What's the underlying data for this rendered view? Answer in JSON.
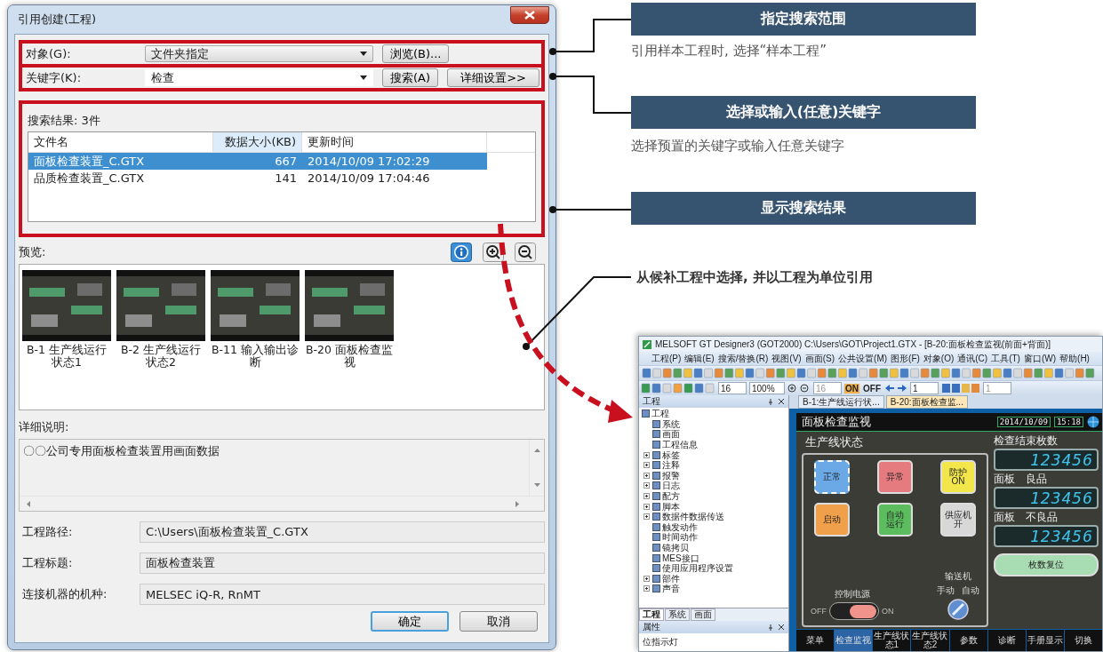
{
  "dialog": {
    "title": "引用创建(工程)",
    "target": {
      "label": "对象(G):",
      "value": "文件夹指定",
      "editable": false,
      "button": "浏览(B)..."
    },
    "keyword": {
      "label": "关键字(K):",
      "value": "检查",
      "editable": true,
      "button": "搜索(A)",
      "detail_button": "详细设置>>"
    },
    "results": {
      "label": "搜索结果: 3件",
      "columns": [
        {
          "label": "文件名",
          "sorted": false
        },
        {
          "label": "数据大小(KB)",
          "sorted": true
        },
        {
          "label": "更新时间",
          "sorted": false
        }
      ],
      "rows": [
        {
          "name": "面板检查装置_C.GTX",
          "size": "667",
          "time": "2014/10/09 17:02:29",
          "selected": true
        },
        {
          "name": "品质检查装置_C.GTX",
          "size": "141",
          "time": "2014/10/09 17:04:46",
          "selected": false
        }
      ]
    },
    "preview": {
      "label": "预览:",
      "items": [
        {
          "caption": "B-1 生产线运行状态1"
        },
        {
          "caption": "B-2 生产线运行状态2"
        },
        {
          "caption": "B-11 输入输出诊断"
        },
        {
          "caption": "B-20 面板检查监视"
        }
      ]
    },
    "description": {
      "label": "详细说明:",
      "text": "〇〇公司专用面板检查装置用画面数据"
    },
    "fields": [
      {
        "label": "工程路径:",
        "value": "C:\\Users\\面板检查装置_C.GTX"
      },
      {
        "label": "工程标题:",
        "value": "面板检查装置"
      },
      {
        "label": "连接机器的机种:",
        "value": "MELSEC iQ-R, RnMT"
      }
    ],
    "buttons": [
      {
        "label": "确定",
        "default": true
      },
      {
        "label": "取消",
        "default": false
      }
    ]
  },
  "callouts": [
    {
      "title": "指定搜索范围",
      "note": "引用样本工程时, 选择“样本工程”"
    },
    {
      "title": "选择或输入(任意)关键字",
      "note": "选择预置的关键字或输入任意关键字"
    },
    {
      "title": "显示搜索结果"
    }
  ],
  "arrow_label": "从候补工程中选择, 并以工程为单位引用",
  "designer": {
    "title": "MELSOFT GT Designer3 (GOT2000) C:\\Users\\GOT\\Project1.GTX  - [B-20:面板检查监视(前面+背面)]",
    "menu": [
      "工程(P)",
      "编辑(E)",
      "搜索/替换(R)",
      "视图(V)",
      "画面(S)",
      "公共设置(M)",
      "图形(F)",
      "对象(O)",
      "通讯(C)",
      "工具(T)",
      "窗口(W)",
      "帮助(H)"
    ],
    "toolbar": {
      "font_size": "16",
      "zoom": "100%",
      "size2": "16",
      "on": "ON",
      "off": "OFF",
      "step": "1",
      "page": "1"
    },
    "project_panel": {
      "title": "工程",
      "tree": {
        "label": "工程",
        "children": [
          {
            "label": "系统"
          },
          {
            "label": "画面"
          },
          {
            "label": "工程信息"
          },
          {
            "label": "标签",
            "expanded": false
          },
          {
            "label": "注释",
            "expanded": false
          },
          {
            "label": "报警",
            "expanded": false
          },
          {
            "label": "日志",
            "expanded": false
          },
          {
            "label": "配方",
            "expanded": false
          },
          {
            "label": "脚本",
            "expanded": false
          },
          {
            "label": "数据件数据传送",
            "expanded": false
          },
          {
            "label": "触发动作"
          },
          {
            "label": "时间动作"
          },
          {
            "label": "镜拷贝"
          },
          {
            "label": "MES接口"
          },
          {
            "label": "使用应用程序设置"
          },
          {
            "label": "部件",
            "expanded": false
          },
          {
            "label": "声音",
            "expanded": false
          }
        ]
      },
      "tabs": [
        {
          "label": "工程",
          "selected": true
        },
        {
          "label": "系统",
          "selected": false
        },
        {
          "label": "画面",
          "selected": false
        }
      ]
    },
    "properties": {
      "title": "属性",
      "value": "位指示灯"
    },
    "doc_tabs": [
      {
        "label": "B-1:生产线运行状...",
        "selected": false
      },
      {
        "label": "B-20:面板检查监...",
        "selected": true
      }
    ],
    "hmi": {
      "title": "面板检查监视",
      "date": "2014/10/09",
      "time": "15:18",
      "section": "生产线状态",
      "lamps": [
        {
          "lines": [
            "正常"
          ],
          "color": "#6aa8e6",
          "selected": true
        },
        {
          "lines": [
            "异常"
          ],
          "color": "#e57b7e",
          "selected": false
        },
        {
          "lines": [
            "防护",
            "ON"
          ],
          "color": "#f2e64a",
          "selected": false
        },
        {
          "lines": [
            "启动"
          ],
          "color": "#f0a04a",
          "selected": false
        },
        {
          "lines": [
            "自动",
            "运行"
          ],
          "color": "#5cbd5e",
          "selected": false
        },
        {
          "lines": [
            "供应机",
            "开"
          ],
          "color": "#d8d8d8",
          "selected": false
        }
      ],
      "power": {
        "label": "控制电源",
        "off_label": "OFF",
        "on_label": "ON",
        "on": true
      },
      "conveyor": {
        "label": "输送机",
        "left": "手动",
        "right": "自动"
      },
      "counters": [
        {
          "label": "检查结束枚数",
          "value": "123456"
        },
        {
          "label": "面板　良品",
          "value": "123456"
        },
        {
          "label": "面板　不良品",
          "value": "123456"
        }
      ],
      "reset_button": "枚数复位",
      "tabs": [
        {
          "label": "菜单",
          "selected": false
        },
        {
          "label": "检查监视",
          "selected": true
        },
        {
          "label": "生产线状态1",
          "selected": false
        },
        {
          "label": "生产线状态2",
          "selected": false
        },
        {
          "label": "参数",
          "selected": false
        },
        {
          "label": "诊断",
          "selected": false
        },
        {
          "label": "手册显示",
          "selected": false
        },
        {
          "label": "切换",
          "selected": false
        }
      ]
    }
  }
}
